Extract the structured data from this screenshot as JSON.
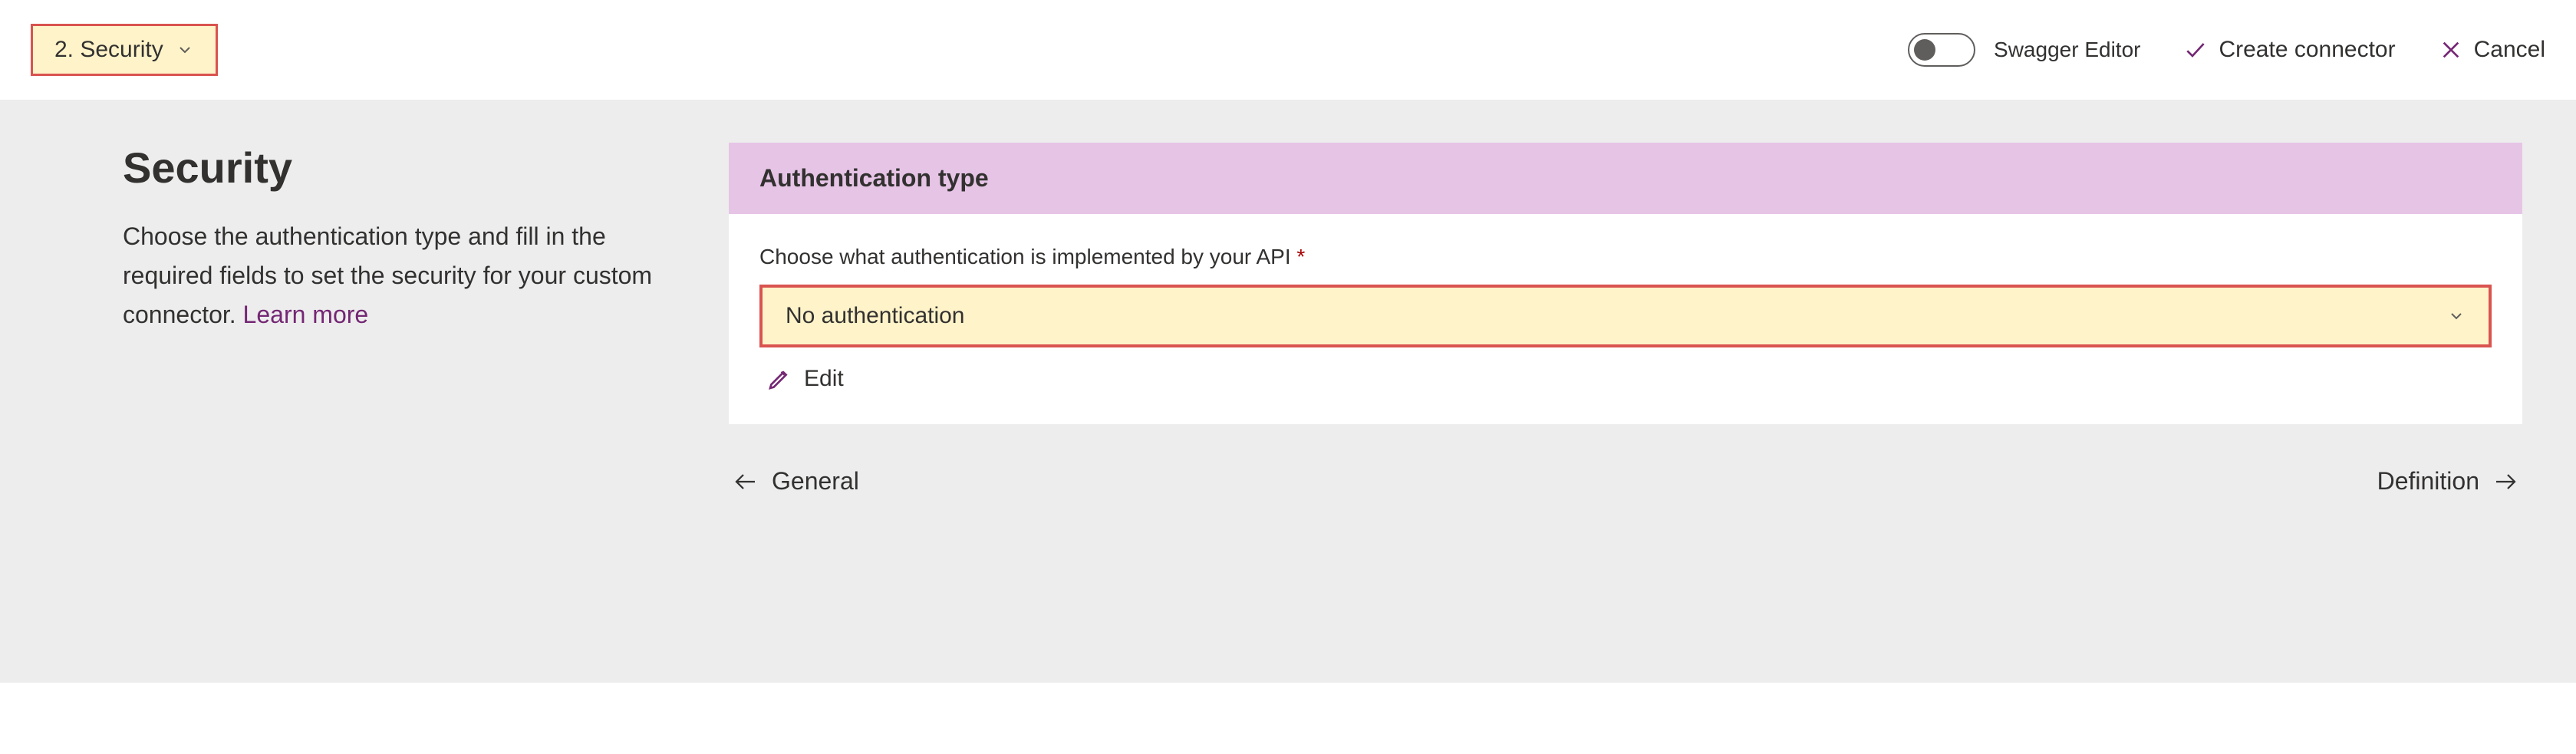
{
  "topbar": {
    "step_label": "2. Security",
    "swagger_label": "Swagger Editor",
    "create_label": "Create connector",
    "cancel_label": "Cancel"
  },
  "left": {
    "heading": "Security",
    "description_prefix": "Choose the authentication type and fill in the required fields to set the security for your custom connector. ",
    "learn_more": "Learn more"
  },
  "card": {
    "header": "Authentication type",
    "field_label": "Choose what authentication is implemented by your API",
    "selected_value": "No authentication",
    "edit_label": "Edit"
  },
  "nav": {
    "prev_label": "General",
    "next_label": "Definition"
  }
}
